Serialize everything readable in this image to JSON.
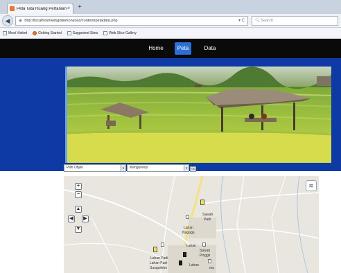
{
  "browser": {
    "tab_title": "Peta Tata Ruang Pertanian ...",
    "tab_close": "×",
    "new_tab": "+",
    "back_glyph": "◀",
    "url": "http://localhost/webgisterkonyoas/content/petadata.php",
    "url_reload": "▾ C",
    "search_placeholder": "Search",
    "bookmarks": [
      {
        "label": "Most Visited",
        "icon": "bookmarks-icon"
      },
      {
        "label": "Getting Started",
        "icon": "firefox-icon"
      },
      {
        "label": "Suggested Sites",
        "icon": "page-icon"
      },
      {
        "label": "Web Slice Gallery",
        "icon": "page-icon"
      }
    ]
  },
  "nav": {
    "items": [
      {
        "label": "Home",
        "active": false
      },
      {
        "label": "Peta",
        "active": true
      },
      {
        "label": "Data",
        "active": false
      }
    ],
    "active_color": "#2b6fd6"
  },
  "banner": {
    "background_color": "#0e3aa6",
    "hero_image": "rice-field-with-huts"
  },
  "filters": {
    "objek": {
      "value": "Pilih Objek"
    },
    "kecamatan": {
      "value": "Mangunrejo"
    },
    "go_label": "Ok"
  },
  "map": {
    "zoom_in": "+",
    "zoom_out": "−",
    "pan_up": "▲",
    "pan_left": "◀",
    "pan_right": "▶",
    "pan_down": "▼",
    "layer_switch_icon": "layers-icon",
    "labels": [
      "Sawah",
      "Padi",
      "Lahan",
      "Nagaga",
      "Lahan",
      "Lahan Padi",
      "Lahan",
      "Sawah",
      "Pinggir",
      "Lahan Padi",
      "Sungailebo",
      "ma"
    ]
  }
}
